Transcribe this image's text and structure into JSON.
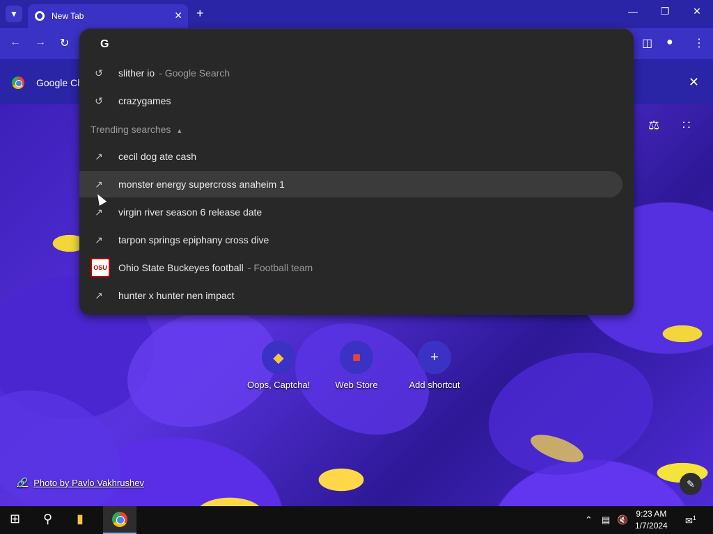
{
  "browser": {
    "tab_title": "New Tab",
    "infobar_text": "Google Chrome"
  },
  "omnibox": {
    "input_glyph": "G",
    "history": [
      {
        "text": "slither io",
        "sub": "- Google Search"
      },
      {
        "text": "crazygames",
        "sub": ""
      }
    ],
    "trending_header": "Trending searches",
    "trending": [
      {
        "text": "cecil dog ate cash",
        "sub": ""
      },
      {
        "text": "monster energy supercross anaheim 1",
        "sub": ""
      },
      {
        "text": "virgin river season 6 release date",
        "sub": ""
      },
      {
        "text": "tarpon springs epiphany cross dive",
        "sub": ""
      },
      {
        "text": "Ohio State Buckeyes football",
        "sub": "- Football team"
      },
      {
        "text": "hunter x hunter nen impact",
        "sub": ""
      }
    ]
  },
  "shortcuts": [
    {
      "label": "Oops, Captcha!",
      "icon": "gamepad-icon"
    },
    {
      "label": "Web Store",
      "icon": "store-icon"
    },
    {
      "label": "Add shortcut",
      "icon": "plus-icon"
    }
  ],
  "photo_credit": "Photo by Pavlo Vakhrushev",
  "taskbar": {
    "time": "9:23 AM",
    "date": "1/7/2024",
    "notification_count": "1"
  }
}
